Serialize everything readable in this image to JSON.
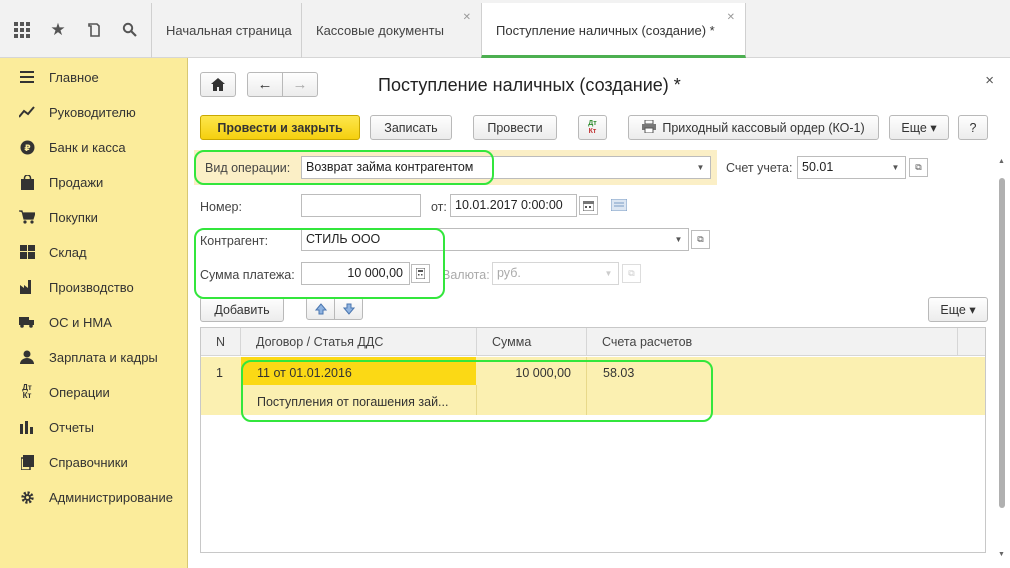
{
  "topbar": {
    "tabs": [
      {
        "label": "Начальная страница"
      },
      {
        "label": "Кассовые документы"
      },
      {
        "label": "Поступление наличных (создание) *"
      }
    ]
  },
  "sidebar": {
    "items": [
      {
        "label": "Главное",
        "icon": "menu-icon"
      },
      {
        "label": "Руководителю",
        "icon": "trend-icon"
      },
      {
        "label": "Банк и касса",
        "icon": "ruble-icon"
      },
      {
        "label": "Продажи",
        "icon": "bag-icon"
      },
      {
        "label": "Покупки",
        "icon": "cart-icon"
      },
      {
        "label": "Склад",
        "icon": "warehouse-icon"
      },
      {
        "label": "Производство",
        "icon": "factory-icon"
      },
      {
        "label": "ОС и НМА",
        "icon": "truck-icon"
      },
      {
        "label": "Зарплата и кадры",
        "icon": "people-icon"
      },
      {
        "label": "Операции",
        "icon": "dt-kt-icon"
      },
      {
        "label": "Отчеты",
        "icon": "bar-chart-icon"
      },
      {
        "label": "Справочники",
        "icon": "book-icon"
      },
      {
        "label": "Администрирование",
        "icon": "gear-icon"
      }
    ]
  },
  "form": {
    "title": "Поступление наличных (создание) *",
    "close": "×",
    "toolbar": {
      "post_close": "Провести и закрыть",
      "save": "Записать",
      "post": "Провести",
      "dtkt_top": "Дт",
      "dtkt_bottom": "Кт",
      "print": "Приходный кассовый ордер (КО-1)",
      "more": "Еще ▾",
      "help": "?"
    },
    "operation_label": "Вид операции:",
    "operation_value": "Возврат займа контрагентом",
    "account_label": "Счет учета:",
    "account_value": "50.01",
    "number_label": "Номер:",
    "number_value": "",
    "date_label": "от:",
    "date_value": "10.01.2017  0:00:00",
    "counterparty_label": "Контрагент:",
    "counterparty_value": "СТИЛЬ ООО",
    "amount_label": "Сумма платежа:",
    "amount_value": "10 000,00",
    "currency_label": "Валюта:",
    "currency_value": "руб."
  },
  "table_toolbar": {
    "add": "Добавить",
    "more": "Еще ▾"
  },
  "table": {
    "columns": [
      "N",
      "Договор / Статья ДДС",
      "Сумма",
      "Счета расчетов"
    ],
    "rows": [
      {
        "n": "1",
        "contract": "11 от 01.01.2016",
        "dds": "Поступления от погашения зай...",
        "sum": "10 000,00",
        "account": "58.03"
      }
    ]
  },
  "colors": {
    "accent": "#f5d00f",
    "sidebar": "#fbec9b",
    "annotation": "#33e63c"
  }
}
